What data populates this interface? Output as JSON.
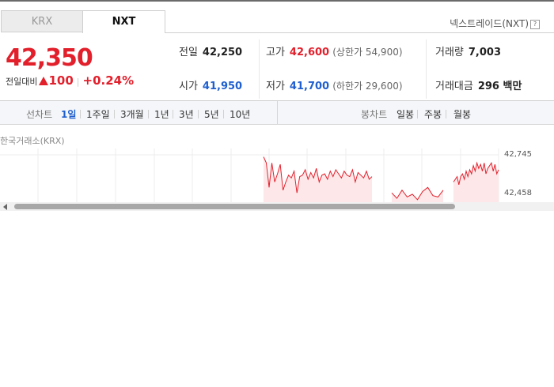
{
  "tabs": [
    {
      "label": "KRX",
      "active": false
    },
    {
      "label": "NXT",
      "active": true
    }
  ],
  "nxt_note": "넥스트레이드(NXT)",
  "help_icon": "?",
  "price": {
    "current": "42,350",
    "change_label": "전일대비",
    "change_amount": "100",
    "change_pct": "+0.24%",
    "direction": "up"
  },
  "stats": {
    "prev_close": {
      "label": "전일",
      "value": "42,250"
    },
    "open": {
      "label": "시가",
      "value": "41,950"
    },
    "high": {
      "label": "고가",
      "value": "42,600",
      "sub": "(상한가 54,900)"
    },
    "low": {
      "label": "저가",
      "value": "41,700",
      "sub": "(하한가 29,600)"
    },
    "volume": {
      "label": "거래량",
      "value": "7,003"
    },
    "amount": {
      "label": "거래대금",
      "value": "296 백만"
    }
  },
  "line_chart": {
    "label": "선차트",
    "periods": [
      {
        "label": "1일",
        "active": true
      },
      {
        "label": "1주일",
        "active": false
      },
      {
        "label": "3개월",
        "active": false
      },
      {
        "label": "1년",
        "active": false
      },
      {
        "label": "3년",
        "active": false
      },
      {
        "label": "5년",
        "active": false
      },
      {
        "label": "10년",
        "active": false
      }
    ]
  },
  "candle_chart": {
    "label": "봉차트",
    "periods": [
      {
        "label": "일봉"
      },
      {
        "label": "주봉"
      },
      {
        "label": "월봉"
      }
    ]
  },
  "exchange_label": "한국거래소(KRX)",
  "chart_data": {
    "type": "area",
    "y_ticks": [
      "42,745",
      "42,458"
    ],
    "ylim": [
      42400,
      42760
    ],
    "series": [
      {
        "values": [
          42745,
          42700,
          42520,
          42700,
          42560,
          42620,
          42690,
          42500,
          42560,
          42610,
          42590,
          42640,
          42480,
          42600,
          42610,
          42650,
          42580,
          42630,
          42590,
          42660,
          42560,
          42610,
          42620,
          42580,
          42640,
          42600,
          42650,
          42620,
          42590,
          42640,
          42610,
          42600,
          42650,
          42560,
          42630,
          42610,
          42590,
          42640,
          42580,
          42600
        ]
      },
      {
        "values": [
          42480,
          42440,
          42500,
          42450,
          42470,
          42430,
          42490,
          42520,
          42460,
          42450,
          42500
        ]
      },
      {
        "values": [
          42560,
          42580,
          42600,
          42540,
          42600,
          42620,
          42580,
          42640,
          42600,
          42650,
          42620,
          42680,
          42640,
          42700,
          42660,
          42690,
          42640,
          42700,
          42620,
          42660,
          42680,
          42700,
          42640,
          42690,
          42620,
          42650
        ]
      }
    ],
    "line_color": "#e2202c",
    "fill_color": "#fde7e8",
    "grid": true
  }
}
